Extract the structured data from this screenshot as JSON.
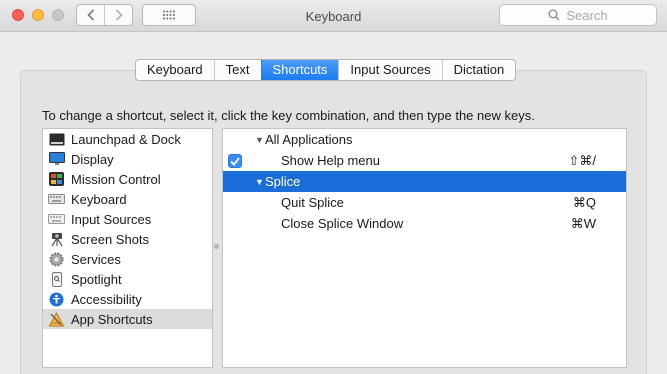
{
  "window": {
    "title": "Keyboard"
  },
  "search": {
    "placeholder": "Search"
  },
  "tabs": [
    {
      "label": "Keyboard",
      "active": false
    },
    {
      "label": "Text",
      "active": false
    },
    {
      "label": "Shortcuts",
      "active": true
    },
    {
      "label": "Input Sources",
      "active": false
    },
    {
      "label": "Dictation",
      "active": false
    }
  ],
  "instruction": "To change a shortcut, select it, click the key combination, and then type the new keys.",
  "categories": [
    {
      "label": "Launchpad & Dock",
      "icon": "launchpad-dock-icon"
    },
    {
      "label": "Display",
      "icon": "display-icon"
    },
    {
      "label": "Mission Control",
      "icon": "mission-control-icon"
    },
    {
      "label": "Keyboard",
      "icon": "keyboard-icon"
    },
    {
      "label": "Input Sources",
      "icon": "input-sources-icon"
    },
    {
      "label": "Screen Shots",
      "icon": "screen-shots-icon"
    },
    {
      "label": "Services",
      "icon": "services-gear-icon"
    },
    {
      "label": "Spotlight",
      "icon": "spotlight-icon"
    },
    {
      "label": "Accessibility",
      "icon": "accessibility-icon"
    },
    {
      "label": "App Shortcuts",
      "icon": "app-shortcuts-icon",
      "selected": true
    }
  ],
  "shortcuts": {
    "all_apps": {
      "label": "All Applications"
    },
    "show_help": {
      "label": "Show Help menu",
      "key": "⇧⌘/",
      "checked": true
    },
    "splice": {
      "label": "Splice"
    },
    "quit_splice": {
      "label": "Quit Splice",
      "key": "⌘Q"
    },
    "close_splice": {
      "label": "Close Splice Window",
      "key": "⌘W"
    }
  },
  "colors": {
    "accent": "#1b6ed8",
    "tab_active": "#1b7cf1"
  }
}
